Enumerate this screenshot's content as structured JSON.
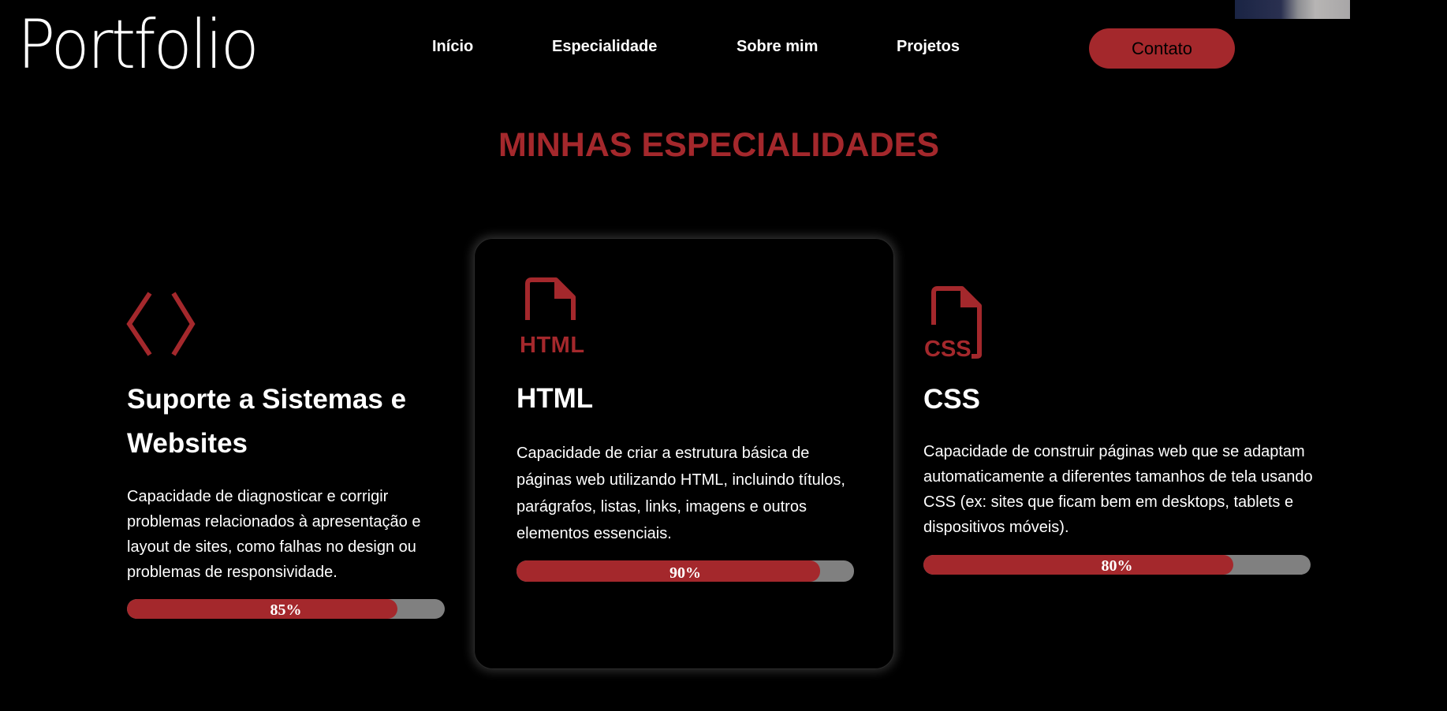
{
  "header": {
    "logo": "Portfolio",
    "nav": [
      "Início",
      "Especialidade",
      "Sobre mim",
      "Projetos"
    ],
    "contact_label": "Contato"
  },
  "section": {
    "title": "MINHAS ESPECIALIDADES"
  },
  "cards": [
    {
      "icon": "code-brackets-icon",
      "title": "Suporte a Sistemas e Websites",
      "description": "Capacidade de diagnosticar e corrigir problemas relacionados à apresentação e layout de sites, como falhas no design ou problemas de responsividade.",
      "progress": 0.85,
      "progress_label": "85%"
    },
    {
      "icon": "html-file-icon",
      "title": "HTML",
      "description": "Capacidade de criar a estrutura básica de páginas web utilizando HTML, incluindo títulos, parágrafos, listas, links, imagens e outros elementos essenciais.",
      "progress": 0.9,
      "progress_label": "90%"
    },
    {
      "icon": "css-file-icon",
      "title": "CSS",
      "description": "Capacidade de construir páginas web que se adaptam automaticamente a diferentes tamanhos de tela usando CSS (ex: sites que ficam bem em desktops, tablets e dispositivos móveis).",
      "progress": 0.8,
      "progress_label": "80%"
    }
  ],
  "colors": {
    "background": "#000000",
    "accent": "#a4282c",
    "track": "#808080",
    "text": "#ffffff"
  }
}
